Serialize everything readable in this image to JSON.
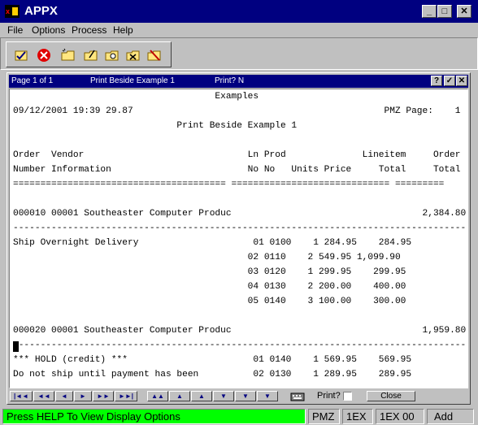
{
  "app": {
    "title": "APPX"
  },
  "window_controls": {
    "minimize": "_",
    "maximize": "□",
    "close": "✕"
  },
  "menu": [
    {
      "label": "File"
    },
    {
      "label": "Options"
    },
    {
      "label": "Process"
    },
    {
      "label": "Help"
    }
  ],
  "toolbar": {
    "tools": [
      {
        "icon": "ok-check-icon"
      },
      {
        "icon": "cancel-icon"
      },
      {
        "icon": "add-folder-icon"
      },
      {
        "icon": "change-folder-icon"
      },
      {
        "icon": "inquire-folder-icon"
      },
      {
        "icon": "delete-folder-icon"
      },
      {
        "icon": "cancel-folder-icon"
      }
    ]
  },
  "child_window": {
    "page": "Page 1 of 1",
    "name": "Print Beside Example 1",
    "print": "Print? N",
    "help": "?",
    "check": "✓",
    "close": "✕"
  },
  "report": {
    "lines": [
      "                                     Examples",
      "09/12/2001 19:39 29.87                                              PMZ Page:    1",
      "                              Print Beside Example 1",
      "",
      "Order  Vendor                              Ln Prod              Lineitem     Order",
      "Number Information                         No No   Units Price     Total     Total",
      "======================================= ============================= =========",
      "",
      "000010 00001 Southeaster Computer Produc                                   2,384.80",
      "------------------------------------------------------------------------------------",
      "Ship Overnight Delivery                     01 0100    1 284.95    284.95",
      "                                           02 0110    2 549.95 1,099.90",
      "                                           03 0120    1 299.95    299.95",
      "                                           04 0130    2 200.00    400.00",
      "                                           05 0140    3 100.00    300.00",
      "",
      "000020 00001 Southeaster Computer Produc                                   1,959.80",
      "------------------------------------------------------------------------------------",
      "*** HOLD (credit) ***                       01 0140    1 569.95    569.95",
      "Do not ship until payment has been          02 0130    1 289.95    289.95"
    ]
  },
  "nav": {
    "buttons": [
      {
        "name": "first-record-button",
        "glyph": "|◄◄"
      },
      {
        "name": "prev-page-button",
        "glyph": "◄◄"
      },
      {
        "name": "prev-button",
        "glyph": "◄"
      },
      {
        "name": "next-button",
        "glyph": "►"
      },
      {
        "name": "next-page-button",
        "glyph": "►►"
      },
      {
        "name": "last-record-button",
        "glyph": "►►|"
      },
      {
        "name": "scroll-top-button",
        "glyph": "▲▲"
      },
      {
        "name": "scroll-up-page-button",
        "glyph": "▲"
      },
      {
        "name": "scroll-up-button",
        "glyph": "▲"
      },
      {
        "name": "scroll-down-button",
        "glyph": "▼"
      },
      {
        "name": "scroll-down-page-button",
        "glyph": "▼"
      },
      {
        "name": "scroll-bottom-button",
        "glyph": "▼"
      }
    ],
    "print_label": "Print?",
    "close_label": "Close"
  },
  "status": {
    "message": "Press HELP To View Display Options",
    "app_id": "PMZ",
    "process": "1EX",
    "frame": "1EX 00",
    "mode": "Add"
  },
  "colors": {
    "titlebar": "#000080",
    "status_message_bg": "#00ff00",
    "window_bg": "#c0c0c0"
  }
}
